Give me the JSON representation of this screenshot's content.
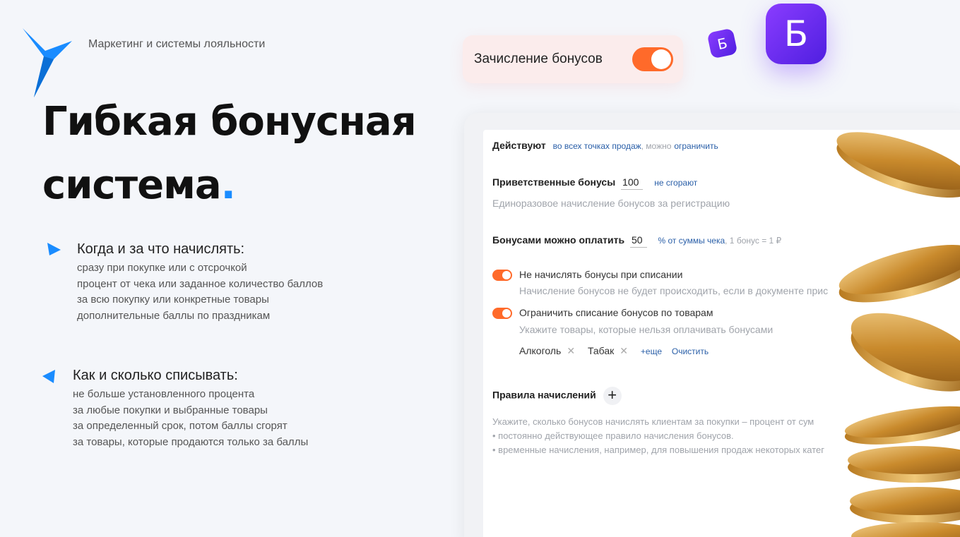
{
  "brand": {
    "tagline": "Маркетинг и системы лояльности",
    "logo_icon": "bird-logo-icon",
    "logo_color": "#1a8cff"
  },
  "headline": {
    "line1": "Гибкая бонусная",
    "line2": "система",
    "dot": "."
  },
  "accrual_block": {
    "title": "Когда и за что начислять:",
    "lines": [
      "сразу при покупке или с отсрочкой",
      "процент от чека или заданное количество баллов",
      "за всю покупку или конкретные товары",
      "дополнительные баллы по праздникам"
    ]
  },
  "writeoff_block": {
    "title": "Как и сколько списывать:",
    "lines": [
      "не больше установленного процента",
      "за любые покупки и выбранные товары",
      "за определенный срок, потом баллы сгорят",
      "за товары, которые продаются только за баллы"
    ]
  },
  "bonus_toggle": {
    "label": "Зачисление бонусов",
    "on": true,
    "color": "#ff6a2a"
  },
  "badges": {
    "small": "Б",
    "big": "Б",
    "gradient_from": "#8a3cff",
    "gradient_to": "#4f1fe0"
  },
  "settings": {
    "active_label": "Действуют",
    "active_scope": "во всех точках продаж",
    "active_sep": ", можно",
    "active_link": "ограничить",
    "welcome_label": "Приветственные бонусы",
    "welcome_value": "100",
    "welcome_suffix": "не сгорают",
    "welcome_hint": "Единоразовое начисление бонусов за регистрацию",
    "pay_label": "Бонусами можно оплатить",
    "pay_value": "50",
    "pay_suffix": "% от суммы чека",
    "pay_rate": ", 1 бонус = 1 ₽",
    "no_accrual_label": "Не начислять бонусы при списании",
    "no_accrual_hint": "Начисление бонусов не будет происходить, если в документе прис",
    "no_accrual_on": true,
    "limit_label": "Ограничить списание бонусов по товарам",
    "limit_hint": "Укажите товары, которые нельзя оплачивать бонусами",
    "limit_on": true,
    "chips": [
      "Алкоголь",
      "Табак"
    ],
    "more_label": "+еще",
    "clear_label": "Очистить",
    "rules_label": "Правила начислений",
    "rules_hint": "Укажите, сколько бонусов начислять клиентам за покупки – процент от сум",
    "rules_bullet1": "• постоянно действующее правило начисления бонусов.",
    "rules_bullet2": "• временные начисления, например, для повышения продаж некоторых катег"
  }
}
